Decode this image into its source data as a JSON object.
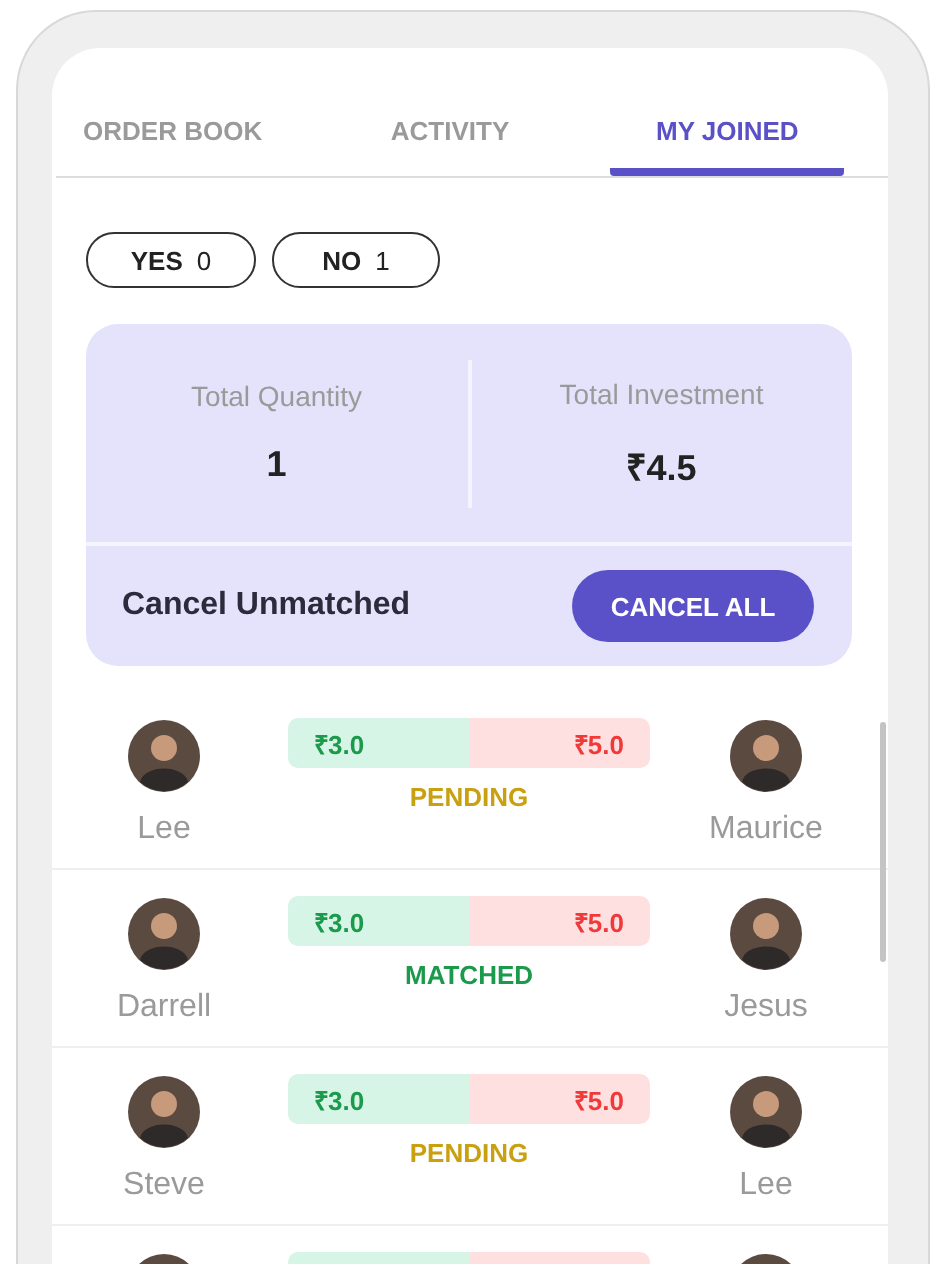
{
  "tabs": [
    {
      "label": "ORDER BOOK",
      "selected": false
    },
    {
      "label": "ACTIVITY",
      "selected": false
    },
    {
      "label": "MY JOINED",
      "selected": true
    }
  ],
  "filters": [
    {
      "label": "YES",
      "count": "0"
    },
    {
      "label": "NO",
      "count": "1"
    }
  ],
  "summary": {
    "stats": [
      {
        "label": "Total Quantity",
        "value": "1"
      },
      {
        "label": "Total Investment",
        "value": "₹4.5"
      }
    ],
    "cancel_label": "Cancel Unmatched",
    "cancel_button": "CANCEL ALL"
  },
  "matches": [
    {
      "left_name": "Lee",
      "right_name": "Maurice",
      "yes_price": "₹3.0",
      "no_price": "₹5.0",
      "status": "PENDING",
      "kind": "pending"
    },
    {
      "left_name": "Darrell",
      "right_name": "Jesus",
      "yes_price": "₹3.0",
      "no_price": "₹5.0",
      "status": "MATCHED",
      "kind": "matched"
    },
    {
      "left_name": "Steve",
      "right_name": "Lee",
      "yes_price": "₹3.0",
      "no_price": "₹5.0",
      "status": "PENDING",
      "kind": "pending"
    }
  ],
  "more_rows_below": true
}
